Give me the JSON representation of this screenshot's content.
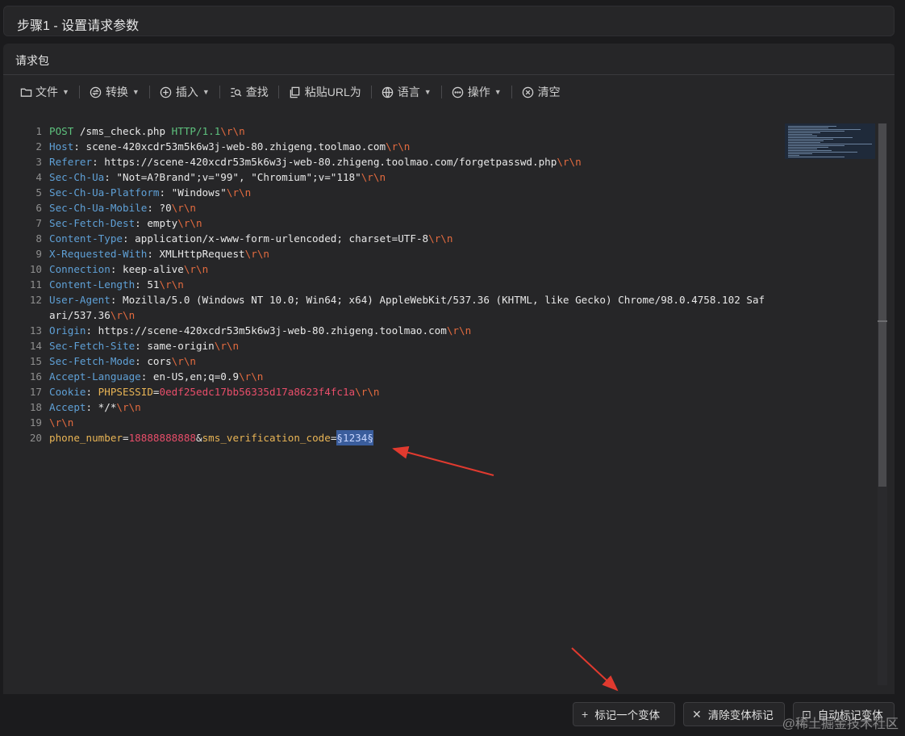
{
  "step": {
    "title": "步骤1 - 设置请求参数"
  },
  "panel": {
    "title": "请求包"
  },
  "toolbar": {
    "file": "文件",
    "convert": "转换",
    "insert": "插入",
    "find": "查找",
    "paste_url": "粘贴URL为",
    "language": "语言",
    "actions": "操作",
    "clear": "清空"
  },
  "editor": {
    "lines": [
      {
        "n": "1",
        "parts": [
          [
            "m",
            "POST"
          ],
          [
            "txt",
            " /sms_check.php "
          ],
          [
            "m",
            "HTTP/1.1"
          ],
          [
            "nl",
            "\\r\\n"
          ]
        ]
      },
      {
        "n": "2",
        "parts": [
          [
            "k",
            "Host"
          ],
          [
            "txt",
            ": scene-420xcdr53m5k6w3j-web-80.zhigeng.toolmao.com"
          ],
          [
            "nl",
            "\\r\\n"
          ]
        ]
      },
      {
        "n": "3",
        "parts": [
          [
            "k",
            "Referer"
          ],
          [
            "txt",
            ": https://scene-420xcdr53m5k6w3j-web-80.zhigeng.toolmao.com/forgetpasswd.php"
          ],
          [
            "nl",
            "\\r\\n"
          ]
        ]
      },
      {
        "n": "4",
        "parts": [
          [
            "k",
            "Sec-Ch-Ua"
          ],
          [
            "txt",
            ": \"Not=A?Brand\";v=\"99\", \"Chromium\";v=\"118\""
          ],
          [
            "nl",
            "\\r\\n"
          ]
        ]
      },
      {
        "n": "5",
        "parts": [
          [
            "k",
            "Sec-Ch-Ua-Platform"
          ],
          [
            "txt",
            ": \"Windows\""
          ],
          [
            "nl",
            "\\r\\n"
          ]
        ]
      },
      {
        "n": "6",
        "parts": [
          [
            "k",
            "Sec-Ch-Ua-Mobile"
          ],
          [
            "txt",
            ": ?0"
          ],
          [
            "nl",
            "\\r\\n"
          ]
        ]
      },
      {
        "n": "7",
        "parts": [
          [
            "k",
            "Sec-Fetch-Dest"
          ],
          [
            "txt",
            ": empty"
          ],
          [
            "nl",
            "\\r\\n"
          ]
        ]
      },
      {
        "n": "8",
        "parts": [
          [
            "k",
            "Content-Type"
          ],
          [
            "txt",
            ": application/x-www-form-urlencoded; charset=UTF-8"
          ],
          [
            "nl",
            "\\r\\n"
          ]
        ]
      },
      {
        "n": "9",
        "parts": [
          [
            "k",
            "X-Requested-With"
          ],
          [
            "txt",
            ": XMLHttpRequest"
          ],
          [
            "nl",
            "\\r\\n"
          ]
        ]
      },
      {
        "n": "10",
        "parts": [
          [
            "k",
            "Connection"
          ],
          [
            "txt",
            ": keep-alive"
          ],
          [
            "nl",
            "\\r\\n"
          ]
        ]
      },
      {
        "n": "11",
        "parts": [
          [
            "k",
            "Content-Length"
          ],
          [
            "txt",
            ": 51"
          ],
          [
            "nl",
            "\\r\\n"
          ]
        ]
      },
      {
        "n": "12",
        "parts": [
          [
            "k",
            "User-Agent"
          ],
          [
            "txt",
            ": Mozilla/5.0 (Windows NT 10.0; Win64; x64) AppleWebKit/537.36 (KHTML, like Gecko) Chrome/98.0.4758.102 Saf"
          ]
        ]
      },
      {
        "n": "",
        "parts": [
          [
            "txt",
            "ari/537.36"
          ],
          [
            "nl",
            "\\r\\n"
          ]
        ]
      },
      {
        "n": "13",
        "parts": [
          [
            "k",
            "Origin"
          ],
          [
            "txt",
            ": https://scene-420xcdr53m5k6w3j-web-80.zhigeng.toolmao.com"
          ],
          [
            "nl",
            "\\r\\n"
          ]
        ]
      },
      {
        "n": "14",
        "parts": [
          [
            "k",
            "Sec-Fetch-Site"
          ],
          [
            "txt",
            ": same-origin"
          ],
          [
            "nl",
            "\\r\\n"
          ]
        ]
      },
      {
        "n": "15",
        "parts": [
          [
            "k",
            "Sec-Fetch-Mode"
          ],
          [
            "txt",
            ": cors"
          ],
          [
            "nl",
            "\\r\\n"
          ]
        ]
      },
      {
        "n": "16",
        "parts": [
          [
            "k",
            "Accept-Language"
          ],
          [
            "txt",
            ": en-US,en;q=0.9"
          ],
          [
            "nl",
            "\\r\\n"
          ]
        ]
      },
      {
        "n": "17",
        "parts": [
          [
            "k",
            "Cookie"
          ],
          [
            "txt",
            ": "
          ],
          [
            "pk",
            "PHPSESSID"
          ],
          [
            "txt",
            "="
          ],
          [
            "ck",
            "0edf25edc17bb56335d17a8623f4fc1a"
          ],
          [
            "nl",
            "\\r\\n"
          ]
        ]
      },
      {
        "n": "18",
        "parts": [
          [
            "k",
            "Accept"
          ],
          [
            "txt",
            ": */*"
          ],
          [
            "nl",
            "\\r\\n"
          ]
        ]
      },
      {
        "n": "19",
        "parts": [
          [
            "nl",
            "\\r\\n"
          ]
        ]
      },
      {
        "n": "20",
        "parts": [
          [
            "pk",
            "phone_number"
          ],
          [
            "txt",
            "="
          ],
          [
            "pv",
            "18888888888"
          ],
          [
            "txt",
            "&"
          ],
          [
            "pk",
            "sms_verification_code"
          ],
          [
            "txt",
            "="
          ],
          [
            "sel",
            "§1234§"
          ]
        ]
      }
    ]
  },
  "buttons": {
    "mark_variable": "标记一个变体",
    "clear_marks": "清除变体标记",
    "auto_mark": "自动标记变体"
  },
  "watermark": "@稀土掘金技术社区",
  "colors": {
    "background": "#1b1b1d",
    "panel": "#262628",
    "header_key": "#5fa0d6",
    "method": "#5ec27e",
    "crlf": "#e36b3f",
    "value_red": "#e84e6a",
    "param_key": "#e8b455",
    "selection": "#3a5d9c",
    "annotation_arrow": "#e03a2f"
  }
}
